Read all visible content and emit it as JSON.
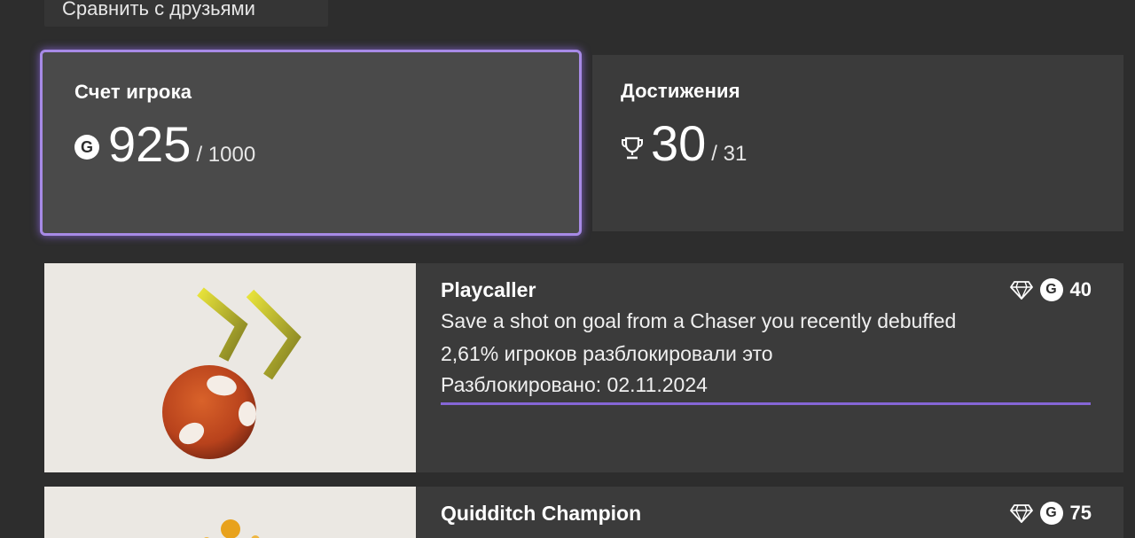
{
  "compare_button": {
    "label": "Сравнить с друзьями"
  },
  "score_tile": {
    "title": "Счет игрока",
    "value": "925",
    "max": "/ 1000",
    "icon": "gamerscore-icon"
  },
  "achievements_tile": {
    "title": "Достижения",
    "value": "30",
    "max": "/ 31",
    "icon": "trophy-icon"
  },
  "achievements": [
    {
      "name": "Playcaller",
      "description": "Save a shot on goal from a Chaser you recently debuffed",
      "percent": "2,61% игроков разблокировали это",
      "unlocked": "Разблокировано: 02.11.2024",
      "points": "40",
      "reward_icon": "diamond-icon"
    },
    {
      "name": "Quidditch Champion",
      "points": "75",
      "reward_icon": "diamond-icon"
    }
  ],
  "colors": {
    "accent": "#a78ae6",
    "underline": "#8566d6",
    "background": "#2d2d2d",
    "tile": "#3b3b3b"
  }
}
